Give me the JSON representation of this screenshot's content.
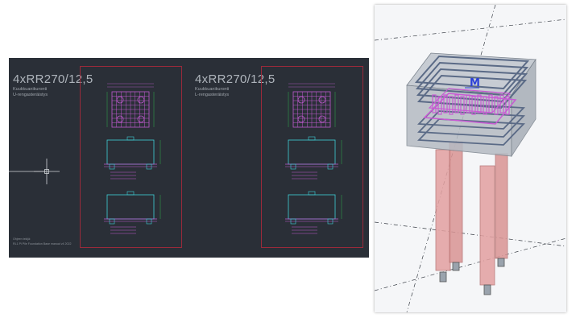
{
  "cad_panel": {
    "background": "#2a2f37",
    "frame_color": "#9a2a3a",
    "drawing_color": "#c05ad0",
    "outline_color": "#3fd0d8",
    "left_block": {
      "title": "4xRR270/12,5",
      "subtitle1": "Kuukkuanikuronti",
      "subtitle2": "U-rengasteräistys",
      "credit_line1": "Ohjeen tekijä:",
      "credit_line2": "RL1 Pi Pile Foundation Base manual v4 2022"
    },
    "right_block": {
      "title": "4xRR270/12,5",
      "subtitle1": "Kuukkuanikuronti",
      "subtitle2": "L-rengasteräistys"
    }
  },
  "model_view": {
    "background": "#f5f6f8",
    "pile_color": "#d98a8a",
    "rebar_color": "#5a6a86",
    "stirrup_color": "#c85ad4",
    "axis_marker": "M"
  }
}
